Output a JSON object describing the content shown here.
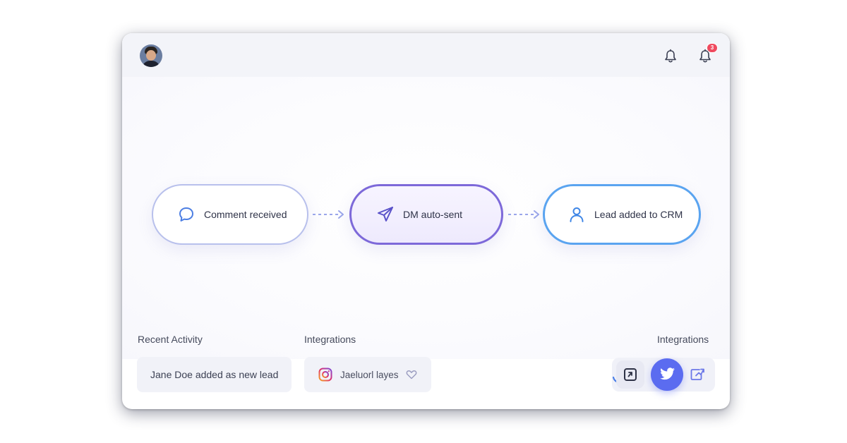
{
  "header": {
    "avatar": "user-avatar",
    "notifications_badge": "3",
    "icons": [
      "bell-icon",
      "bell-icon"
    ]
  },
  "flow": {
    "steps": [
      {
        "label": "Comment received",
        "icon": "chat-bubble-icon"
      },
      {
        "label": "DM auto-sent",
        "icon": "paper-plane-icon"
      },
      {
        "label": "Lead added to CRM",
        "icon": "user-icon"
      }
    ]
  },
  "recent_activity": {
    "title": "Recent Activity",
    "item": "Jane Doe added as new lead"
  },
  "integrations": {
    "title": "Integrations",
    "item_label": "Jaeluorl layes",
    "item_icon": "instagram-icon"
  },
  "integrations_right": {
    "title": "Integrations",
    "buttons": [
      "app-square-icon",
      "twitter-icon",
      "share-box-icon"
    ]
  },
  "colors": {
    "accent_purple": "#7d69d9",
    "accent_blue": "#5aa4f0",
    "twitter_blue": "#5b6cf0",
    "badge_red": "#ef4a5f"
  }
}
